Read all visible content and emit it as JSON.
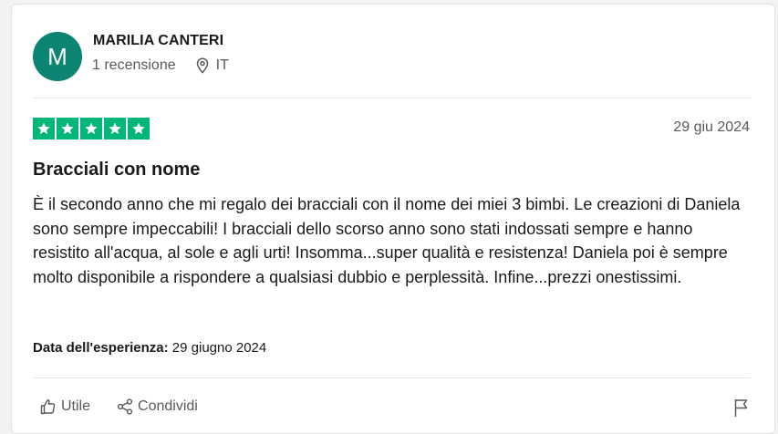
{
  "reviewer": {
    "initial": "M",
    "name": "MARILIA CANTERI",
    "reviews_count": "1 recensione",
    "country": "IT",
    "avatar_color": "#0b8472"
  },
  "review": {
    "rating": 5,
    "star_color": "#00b67a",
    "date": "29 giu 2024",
    "title": "Bracciali con nome",
    "body": "È il secondo anno che mi regalo dei bracciali con il nome dei miei 3 bimbi. Le creazioni di Daniela sono sempre impeccabili! I bracciali dello scorso anno sono stati indossati sempre e hanno resistito all'acqua, al sole e agli urti! Insomma...super qualità e resistenza! Daniela poi è sempre molto disponibile a rispondere a qualsiasi dubbio e perplessità. Infine...prezzi onestissimi.",
    "experience_label": "Data dell'esperienza:",
    "experience_date": "29 giugno 2024"
  },
  "actions": {
    "useful_label": "Utile",
    "share_label": "Condividi",
    "useful_icon": "thumbs-up-icon",
    "share_icon": "share-icon",
    "report_icon": "flag-icon"
  }
}
